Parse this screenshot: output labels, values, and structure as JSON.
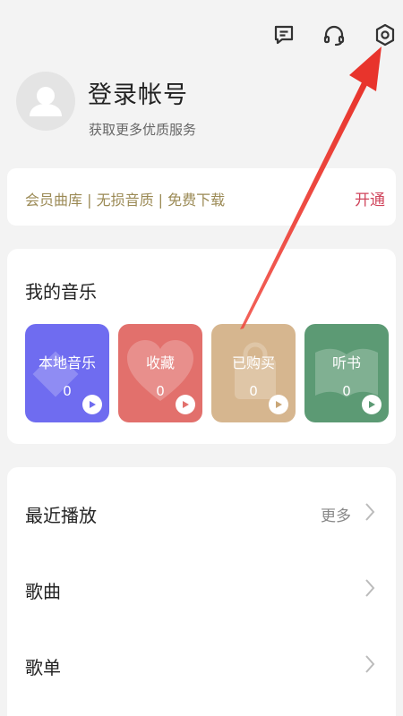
{
  "header": {
    "icons": [
      "message-icon",
      "headset-icon",
      "settings-icon"
    ]
  },
  "profile": {
    "title": "登录帐号",
    "subtitle": "获取更多优质服务"
  },
  "vip": {
    "text": "会员曲库 | 无损音质 | 免费下载",
    "action": "开通"
  },
  "my_music": {
    "title": "我的音乐",
    "tiles": [
      {
        "label": "本地音乐",
        "count": "0",
        "color": "#6f6cf0"
      },
      {
        "label": "收藏",
        "count": "0",
        "color": "#e2706c"
      },
      {
        "label": "已购买",
        "count": "0",
        "color": "#d6b68f"
      },
      {
        "label": "听书",
        "count": "0",
        "color": "#5c9a74"
      }
    ]
  },
  "list": {
    "recent": "最近播放",
    "more": "更多",
    "songs": "歌曲",
    "playlists": "歌单"
  },
  "colors": {
    "accent_red": "#d0455c",
    "vip_gold": "#9b8a55",
    "annotation_arrow": "#f0463c"
  }
}
